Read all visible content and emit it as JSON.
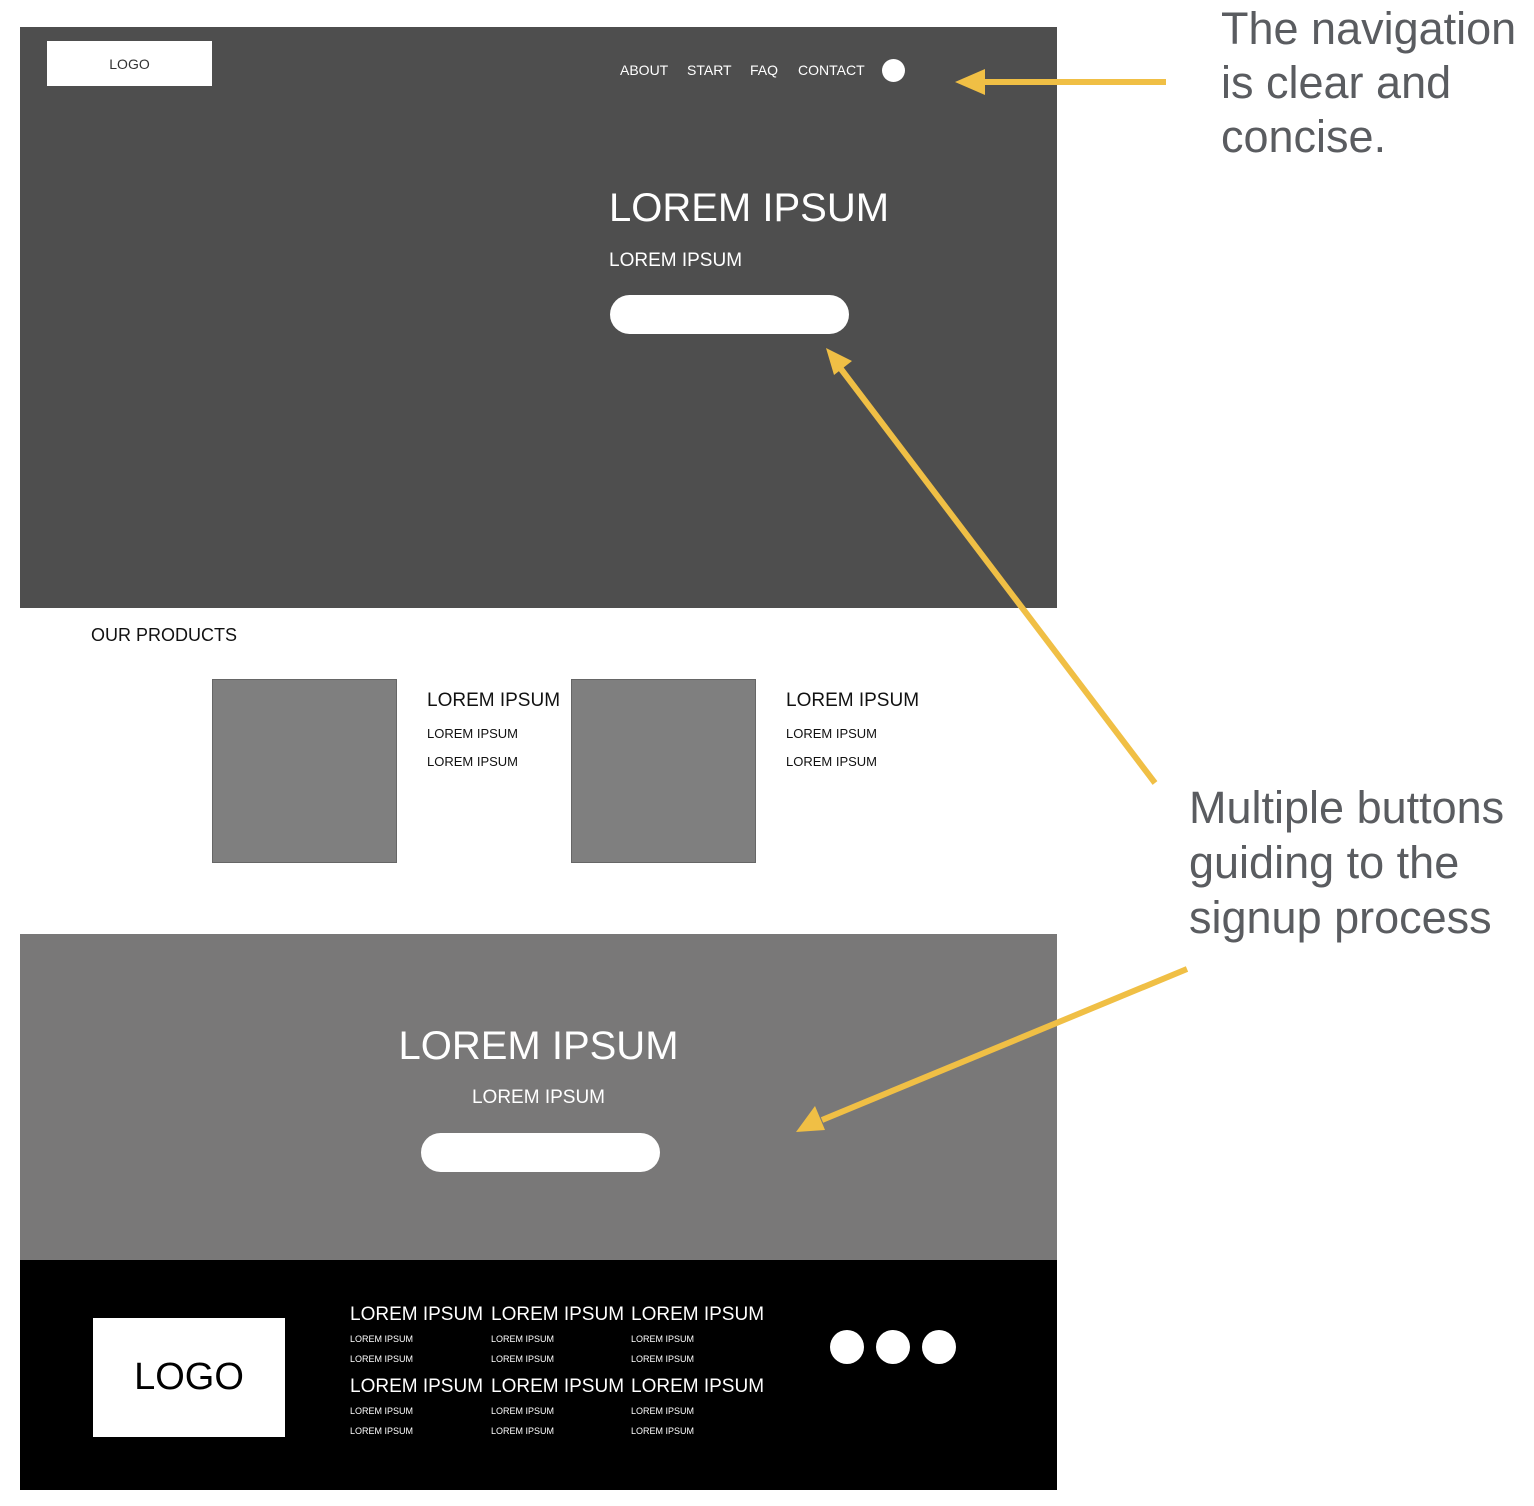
{
  "hero": {
    "logo": "LOGO",
    "nav": [
      "ABOUT",
      "START",
      "FAQ",
      "CONTACT"
    ],
    "title": "LOREM IPSUM",
    "subtitle": "LOREM IPSUM"
  },
  "products": {
    "heading": "OUR PRODUCTS",
    "items": [
      {
        "title": "LOREM IPSUM",
        "lines": [
          "LOREM IPSUM",
          "LOREM IPSUM"
        ]
      },
      {
        "title": "LOREM IPSUM",
        "lines": [
          "LOREM IPSUM",
          "LOREM IPSUM"
        ]
      }
    ]
  },
  "cta": {
    "title": "LOREM IPSUM",
    "subtitle": "LOREM IPSUM"
  },
  "footer": {
    "logo": "LOGO",
    "columns": [
      {
        "title": "LOREM IPSUM",
        "lines": [
          "LOREM IPSUM",
          "LOREM IPSUM"
        ]
      },
      {
        "title": "LOREM IPSUM",
        "lines": [
          "LOREM IPSUM",
          "LOREM IPSUM"
        ]
      },
      {
        "title": "LOREM IPSUM",
        "lines": [
          "LOREM IPSUM",
          "LOREM IPSUM"
        ]
      },
      {
        "title": "LOREM IPSUM",
        "lines": [
          "LOREM IPSUM",
          "LOREM IPSUM"
        ]
      },
      {
        "title": "LOREM IPSUM",
        "lines": [
          "LOREM IPSUM",
          "LOREM IPSUM"
        ]
      },
      {
        "title": "LOREM IPSUM",
        "lines": [
          "LOREM IPSUM",
          "LOREM IPSUM"
        ]
      }
    ],
    "social_icons": [
      "social-icon",
      "social-icon",
      "social-icon"
    ]
  },
  "annotations": {
    "navigation_note": [
      "The navigation",
      "is clear and",
      "concise."
    ],
    "buttons_note": [
      "Multiple buttons",
      "guiding to the",
      "signup process"
    ],
    "arrow_color": "#f0bf45"
  }
}
